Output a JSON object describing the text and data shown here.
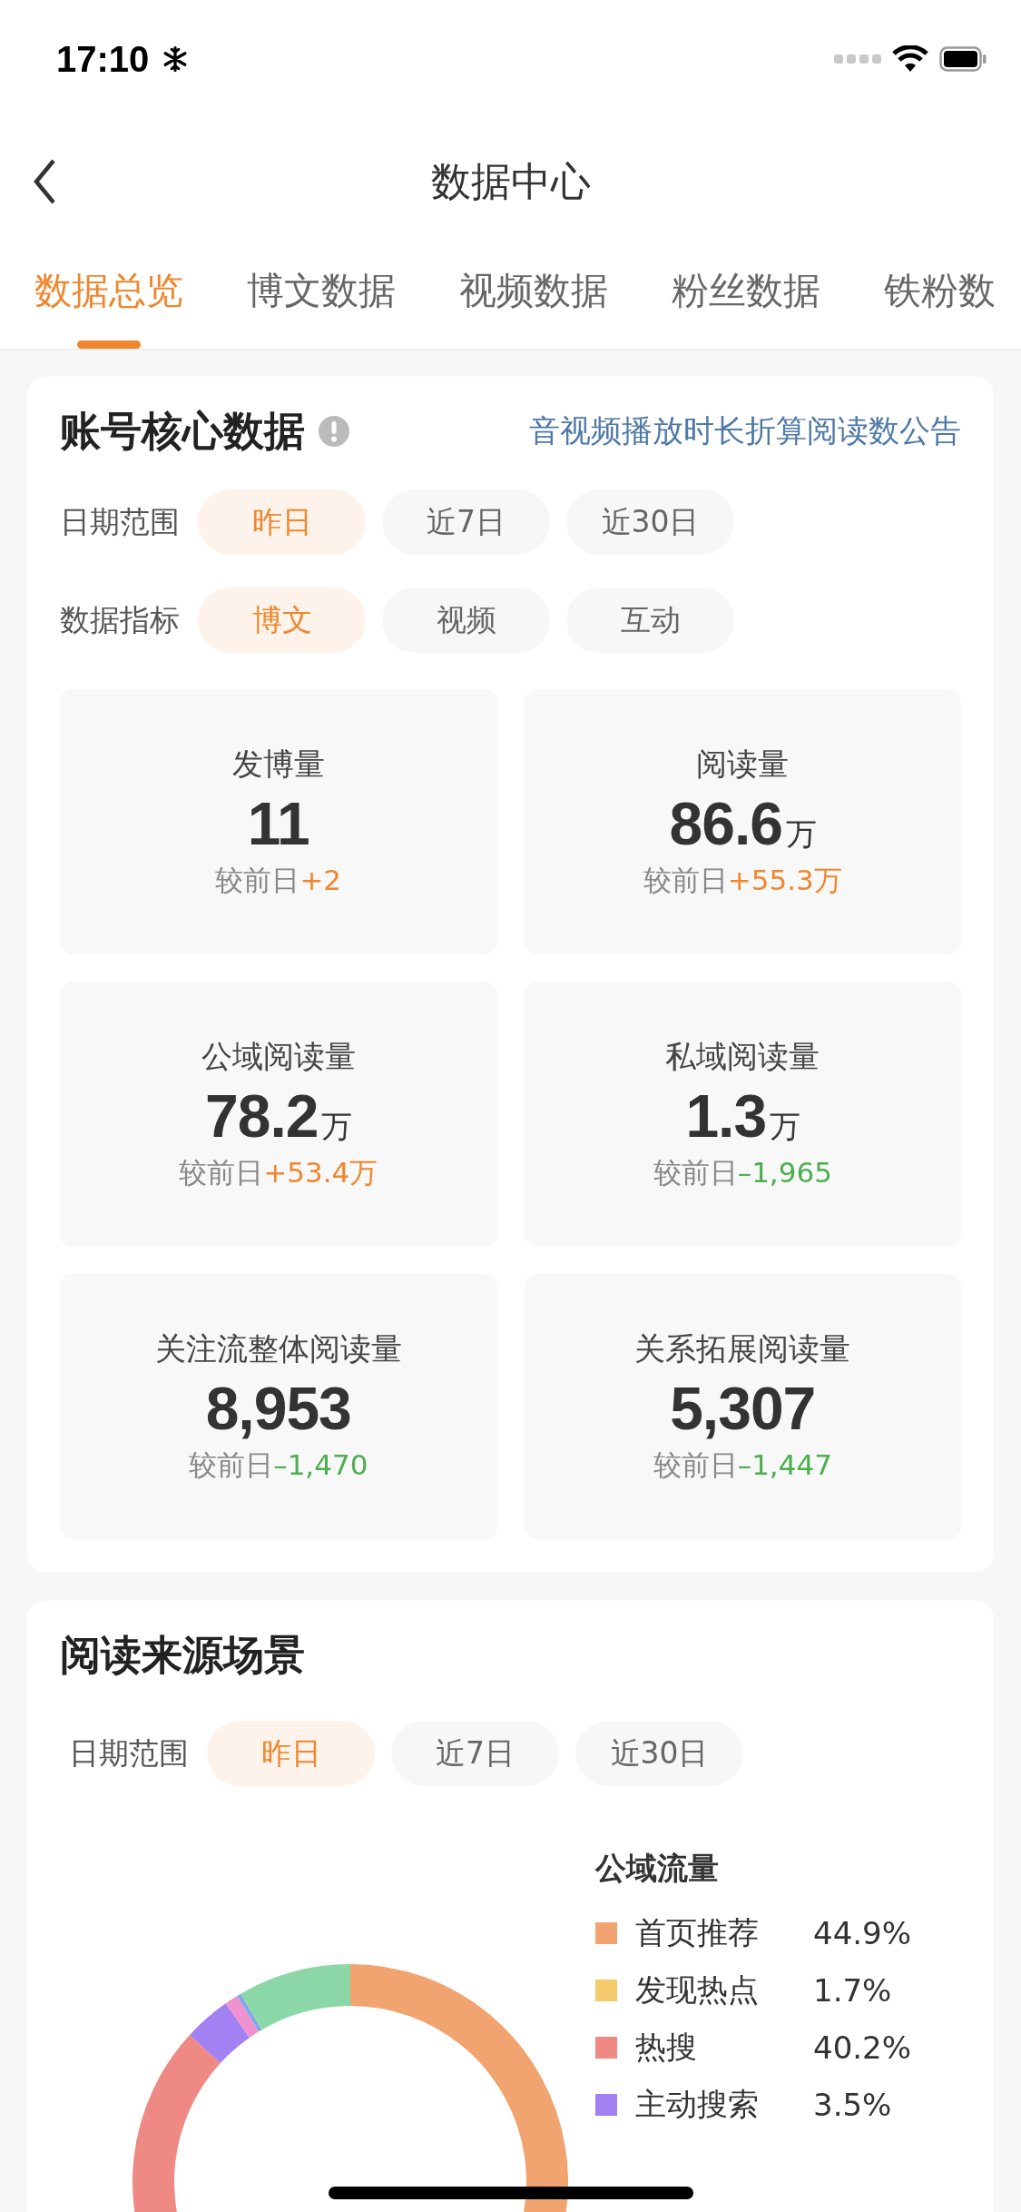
{
  "status_bar": {
    "time": "17:10"
  },
  "nav": {
    "title": "数据中心"
  },
  "tabs": [
    {
      "label": "数据总览",
      "selected": true
    },
    {
      "label": "博文数据",
      "selected": false
    },
    {
      "label": "视频数据",
      "selected": false
    },
    {
      "label": "粉丝数据",
      "selected": false
    },
    {
      "label": "铁粉数",
      "selected": false
    }
  ],
  "core_card": {
    "title": "账号核心数据",
    "link": "音视频播放时长折算阅读数公告",
    "filters": [
      {
        "label": "日期范围",
        "options": [
          {
            "label": "昨日",
            "selected": true
          },
          {
            "label": "近7日",
            "selected": false
          },
          {
            "label": "近30日",
            "selected": false
          }
        ]
      },
      {
        "label": "数据指标",
        "options": [
          {
            "label": "博文",
            "selected": true
          },
          {
            "label": "视频",
            "selected": false
          },
          {
            "label": "互动",
            "selected": false
          }
        ]
      }
    ],
    "metrics": [
      {
        "label": "发博量",
        "value": "11",
        "compare": "较前日",
        "delta": "+2",
        "rising": true
      },
      {
        "label": "阅读量",
        "value": "86.6",
        "unit": "万",
        "compare": "较前日",
        "delta": "+55.3万",
        "rising": true
      },
      {
        "label": "公域阅读量",
        "value": "78.2",
        "unit": "万",
        "compare": "较前日",
        "delta": "+53.4万",
        "rising": true
      },
      {
        "label": "私域阅读量",
        "value": "1.3",
        "unit": "万",
        "compare": "较前日",
        "delta": "–1,965",
        "rising": false
      },
      {
        "label": "关注流整体阅读量",
        "value": "8,953",
        "compare": "较前日",
        "delta": "–1,470",
        "rising": false
      },
      {
        "label": "关系拓展阅读量",
        "value": "5,307",
        "compare": "较前日",
        "delta": "–1,447",
        "rising": false
      }
    ]
  },
  "source_card": {
    "title": "阅读来源场景",
    "filter": {
      "label": "日期范围",
      "options": [
        {
          "label": "昨日",
          "selected": true
        },
        {
          "label": "近7日",
          "selected": false
        },
        {
          "label": "近30日",
          "selected": false
        }
      ]
    },
    "legend_groups": [
      {
        "title": "公域流量",
        "items": [
          {
            "label": "首页推荐",
            "value": "44.9%",
            "color": "#f2a470"
          },
          {
            "label": "发现热点",
            "value": "1.7%",
            "color": "#f6cb6b"
          },
          {
            "label": "热搜",
            "value": "40.2%",
            "color": "#ef8984"
          },
          {
            "label": "主动搜索",
            "value": "3.5%",
            "color": "#a281f2"
          }
        ]
      }
    ]
  }
}
